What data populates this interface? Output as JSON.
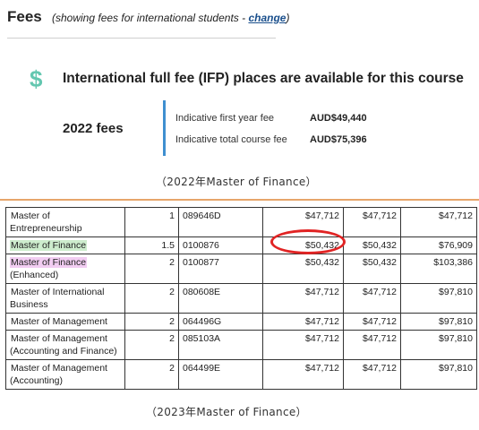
{
  "header": {
    "title": "Fees",
    "note_prefix": "(showing fees for international students - ",
    "change_link": "change",
    "note_suffix": ")"
  },
  "ifp": {
    "icon": "dollar-icon",
    "icon_glyph": "$",
    "heading": "International full fee (IFP) places are available for this course"
  },
  "fees2022": {
    "year_label": "2022 fees",
    "first_year_label": "Indicative first year fee",
    "first_year_value": "AUD$49,440",
    "total_label": "Indicative total course fee",
    "total_value": "AUD$75,396"
  },
  "caption_2022": "（2022年Master of Finance）",
  "caption_2023": "（2023年Master of Finance）",
  "table": {
    "rows": [
      {
        "program": "Master of Entrepreneurship",
        "years": "1",
        "code": "089646D",
        "fee1": "$47,712",
        "fee2": "$47,712",
        "total": "$47,712",
        "highlight": ""
      },
      {
        "program": "Master of Finance",
        "years": "1.5",
        "code": "0100876",
        "fee1": "$50,432",
        "fee2": "$50,432",
        "total": "$76,909",
        "highlight": "#cdeccd"
      },
      {
        "program": "Master of Finance",
        "program_extra": "(Enhanced)",
        "years": "2",
        "code": "0100877",
        "fee1": "$50,432",
        "fee2": "$50,432",
        "total": "$103,386",
        "highlight": "#f2cdf2"
      },
      {
        "program": "Master of International Business",
        "years": "2",
        "code": "080608E",
        "fee1": "$47,712",
        "fee2": "$47,712",
        "total": "$97,810",
        "highlight": ""
      },
      {
        "program": "Master of Management",
        "years": "2",
        "code": "064496G",
        "fee1": "$47,712",
        "fee2": "$47,712",
        "total": "$97,810",
        "highlight": ""
      },
      {
        "program": "Master of Management (Accounting and Finance)",
        "years": "2",
        "code": "085103A",
        "fee1": "$47,712",
        "fee2": "$47,712",
        "total": "$97,810",
        "highlight": ""
      },
      {
        "program": "Master of Management (Accounting)",
        "years": "2",
        "code": "064499E",
        "fee1": "$47,712",
        "fee2": "$47,712",
        "total": "$97,810",
        "highlight": ""
      }
    ]
  },
  "colors": {
    "accent_teal": "#64c7b0",
    "divider_blue": "#3f8fd0",
    "annotation_red": "#e12424",
    "rule_orange": "#e7a56a"
  }
}
